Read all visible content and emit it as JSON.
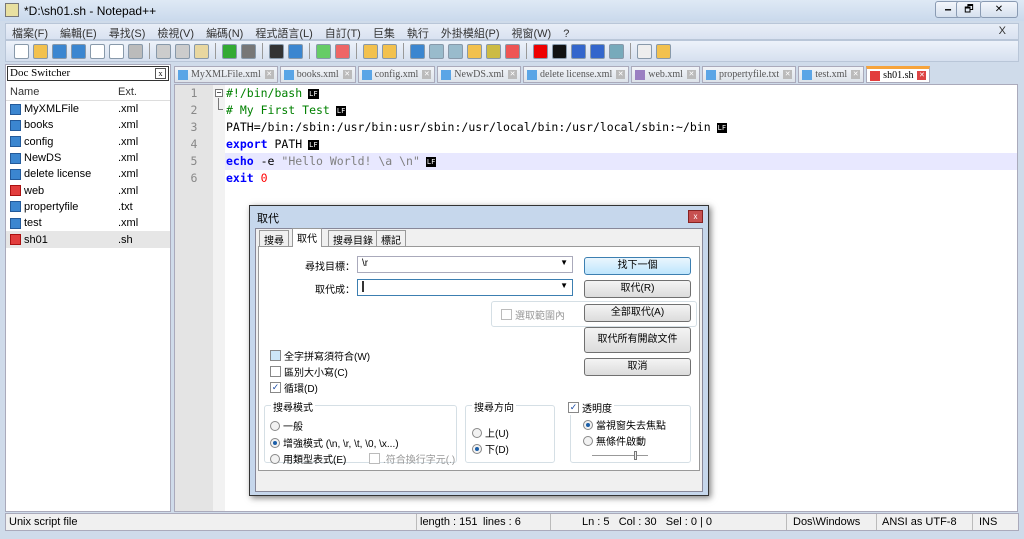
{
  "window": {
    "title": "*D:\\sh01.sh - Notepad++",
    "min": "🗕",
    "max": "🗗",
    "close": "✕"
  },
  "menu": [
    "檔案(F)",
    "編輯(E)",
    "尋找(S)",
    "檢視(V)",
    "編碼(N)",
    "程式語言(L)",
    "自訂(T)",
    "巨集",
    "執行",
    "外掛模組(P)",
    "視窗(W)",
    "?"
  ],
  "menu_close": "X",
  "toolbar": [
    {
      "icon": "new-file-icon",
      "c": "#fff"
    },
    {
      "icon": "open-folder-icon",
      "c": "#f2c14e"
    },
    {
      "icon": "save-icon",
      "c": "#3b86d0"
    },
    {
      "icon": "save-all-icon",
      "c": "#3b86d0"
    },
    {
      "icon": "close-icon",
      "c": "#fff"
    },
    {
      "icon": "close-all-icon",
      "c": "#fff"
    },
    {
      "icon": "print-icon",
      "c": "#bbb"
    },
    {
      "sep": true
    },
    {
      "icon": "cut-icon",
      "c": "#ccc"
    },
    {
      "icon": "copy-icon",
      "c": "#ccc"
    },
    {
      "icon": "paste-icon",
      "c": "#e8d7a0"
    },
    {
      "sep": true
    },
    {
      "icon": "undo-icon",
      "c": "#3a3"
    },
    {
      "icon": "redo-icon",
      "c": "#777"
    },
    {
      "sep": true
    },
    {
      "icon": "find-icon",
      "c": "#333"
    },
    {
      "icon": "replace-icon",
      "c": "#3b86d0"
    },
    {
      "sep": true
    },
    {
      "icon": "zoom-in-icon",
      "c": "#6c6"
    },
    {
      "icon": "zoom-out-icon",
      "c": "#e66"
    },
    {
      "sep": true
    },
    {
      "icon": "sync-vertical-icon",
      "c": "#f2c14e"
    },
    {
      "icon": "sync-horizontal-icon",
      "c": "#f2c14e"
    },
    {
      "sep": true
    },
    {
      "icon": "word-wrap-icon",
      "c": "#3b86d0"
    },
    {
      "icon": "show-all-chars-icon",
      "c": "#9bc"
    },
    {
      "icon": "indent-guide-icon",
      "c": "#9bc"
    },
    {
      "icon": "user-lang-icon",
      "c": "#f2c14e"
    },
    {
      "icon": "doc-map-icon",
      "c": "#cb4"
    },
    {
      "icon": "function-list-icon",
      "c": "#e55"
    },
    {
      "sep": true
    },
    {
      "icon": "record-macro-icon",
      "c": "#e00"
    },
    {
      "icon": "stop-macro-icon",
      "c": "#111"
    },
    {
      "icon": "play-macro-icon",
      "c": "#36c"
    },
    {
      "icon": "run-macro-multiple-icon",
      "c": "#36c"
    },
    {
      "icon": "save-macro-icon",
      "c": "#7ab"
    },
    {
      "sep": true
    },
    {
      "icon": "doc-switcher-icon",
      "c": "#eee"
    },
    {
      "icon": "plugin-icon",
      "c": "#f2c14e"
    }
  ],
  "doc_switcher": {
    "title": "Doc Switcher",
    "close": "x",
    "col_name": "Name",
    "col_ext": "Ext.",
    "files": [
      {
        "name": "MyXMLFile",
        "ext": ".xml",
        "red": false
      },
      {
        "name": "books",
        "ext": ".xml",
        "red": false
      },
      {
        "name": "config",
        "ext": ".xml",
        "red": false
      },
      {
        "name": "NewDS",
        "ext": ".xml",
        "red": false
      },
      {
        "name": "delete license",
        "ext": ".xml",
        "red": false
      },
      {
        "name": "web",
        "ext": ".xml",
        "red": true
      },
      {
        "name": "propertyfile",
        "ext": ".txt",
        "red": false
      },
      {
        "name": "test",
        "ext": ".xml",
        "red": false
      },
      {
        "name": "sh01",
        "ext": ".sh",
        "red": true
      }
    ]
  },
  "tabs": [
    {
      "label": "MyXMLFile.xml"
    },
    {
      "label": "books.xml"
    },
    {
      "label": "config.xml"
    },
    {
      "label": "NewDS.xml"
    },
    {
      "label": "delete license.xml"
    },
    {
      "label": "web.xml"
    },
    {
      "label": "propertyfile.txt"
    },
    {
      "label": "test.xml"
    },
    {
      "label": "sh01.sh",
      "active": true
    }
  ],
  "editor": {
    "eol": "LF",
    "lines": [
      [
        {
          "t": "#!/bin/bash",
          "c": "cm"
        }
      ],
      [
        {
          "t": "# My First Test",
          "c": "cm"
        }
      ],
      [
        {
          "t": "PATH=/bin:/sbin:/usr/bin:usr/sbin:/usr/local/bin:/usr/local/sbin:~/bin",
          "c": ""
        }
      ],
      [
        {
          "t": "export",
          "c": "kw"
        },
        {
          "t": " PATH",
          "c": ""
        }
      ],
      [
        {
          "t": "echo",
          "c": "kw"
        },
        {
          "t": " -e ",
          "c": ""
        },
        {
          "t": "\"Hello World! \\a \\n\"",
          "c": "st"
        }
      ],
      [
        {
          "t": "exit",
          "c": "kw"
        },
        {
          "t": " ",
          "c": ""
        },
        {
          "t": "0",
          "c": "nm"
        }
      ]
    ],
    "current_line": 5
  },
  "status": {
    "type": "Unix script file",
    "length": "length : 151",
    "lines": "lines : 6",
    "pos": "Ln : 5   Col : 30   Sel : 0 | 0",
    "eol": "Dos\\Windows",
    "enc": "ANSI as UTF-8",
    "mode": "INS"
  },
  "dialog": {
    "title": "取代",
    "close": "x",
    "tabs": [
      "搜尋",
      "取代",
      "搜尋目錄",
      "標記"
    ],
    "find_label": "尋找目標：",
    "find_value": "\\r",
    "replace_label": "取代成：",
    "replace_value": "",
    "in_selection": "選取範圍內",
    "find_next": "找下一個",
    "replace": "取代(R)",
    "replace_all": "全部取代(A)",
    "replace_all_open": "取代所有開啟文件",
    "cancel": "取消",
    "whole_word": "全字拼寫須符合(W)",
    "match_case": "區別大小寫(C)",
    "wrap": "循環(D)",
    "mode_title": "搜尋模式",
    "mode_normal": "一般",
    "mode_extended": "增強模式 (\\n, \\r, \\t, \\0, \\x...)",
    "mode_regex": "用類型表式(E)",
    "dot_newline": ".符合換行字元(.)",
    "dir_title": "搜尋方向",
    "dir_up": "上(U)",
    "dir_down": "下(D)",
    "trans_title": "透明度",
    "trans_focus": "當視窗失去焦點",
    "trans_always": "無條件啟動",
    "transparency": 0.75
  }
}
